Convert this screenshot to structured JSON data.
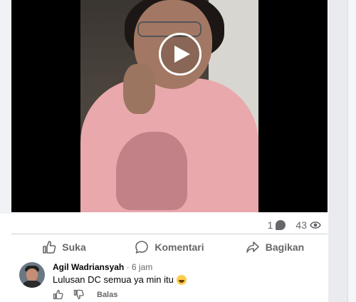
{
  "post": {
    "stats": {
      "comments_count": "1",
      "views_count": "43"
    },
    "actions": [
      {
        "label": "Suka",
        "icon": "like-icon"
      },
      {
        "label": "Komentari",
        "icon": "comment-icon"
      },
      {
        "label": "Bagikan",
        "icon": "share-icon"
      }
    ]
  },
  "comment": {
    "author": "Agil Wadriansyah",
    "time": "· 6 jam",
    "text": "Lulusan DC semua ya min itu",
    "emoji": "grinning-sweat-emoji",
    "reply_label": "Balas"
  },
  "colors": {
    "text_secondary": "#65676b",
    "divider": "#ced0d4",
    "video_bg": "#000000"
  }
}
